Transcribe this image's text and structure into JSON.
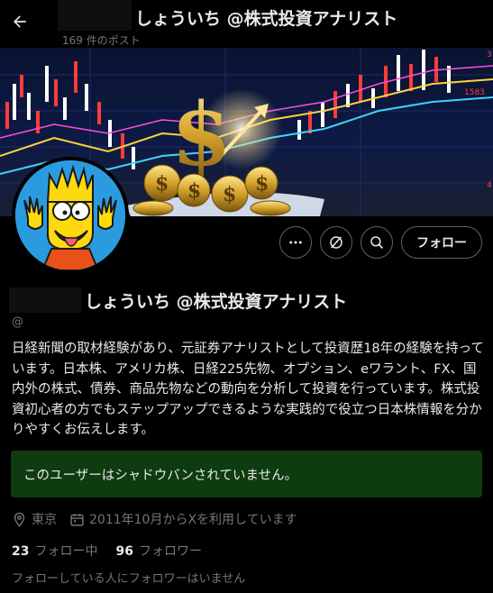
{
  "header": {
    "title": "しょういち @株式投資アナリスト",
    "post_count": "169 件のポスト"
  },
  "profile": {
    "display_name": "しょういち @株式投資アナリスト",
    "handle": "@",
    "bio": "日経新聞の取材経験があり、元証券アナリストとして投資歴18年の経験を持っています。日本株、アメリカ株、日経225先物、オプション、eワラント、FX、国内外の株式、債券、商品先物などの動向を分析して投資を行っています。株式投資初心者の方でもステップアップできるような実践的で役立つ日本株情報を分かりやすくお伝えします。",
    "location": "東京",
    "joined": "2011年10月からXを利用しています",
    "following_count": "23",
    "following_label": "フォロー中",
    "followers_count": "96",
    "followers_label": "フォロワー",
    "no_followers_you_know": "フォローしている人にフォロワーはいません"
  },
  "actions": {
    "follow_label": "フォロー"
  },
  "notice": {
    "shadowban_text": "このユーザーはシャドウバンされていません。"
  },
  "banner": {
    "price_labels": [
      "1583",
      "3",
      "4"
    ]
  },
  "colors": {
    "background": "#000000",
    "text": "#e7e9ea",
    "secondary_text": "#71767b",
    "notice_bg": "#0e3b0f",
    "avatar_bg": "#2b9be0",
    "banner_bg": "#0d1a45"
  },
  "icons": [
    "back-arrow-icon",
    "more-icon",
    "grok-icon",
    "search-icon",
    "location-icon",
    "calendar-icon"
  ]
}
